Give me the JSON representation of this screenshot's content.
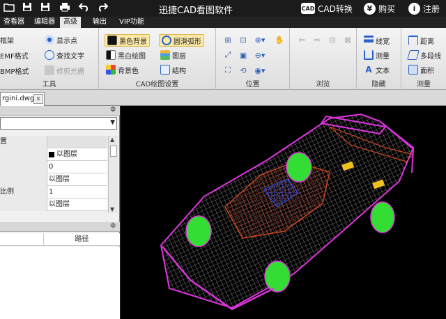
{
  "titlebar": {
    "title": "迅捷CAD看图软件",
    "cad_badge": "CAD",
    "convert_label": "CAD转换",
    "buy_label": "购买",
    "register_label": "注册",
    "yen": "¥",
    "info": "i"
  },
  "tabs": [
    "查看器",
    "编辑器",
    "高级",
    "输出",
    "VIP功能"
  ],
  "ribbon": {
    "tools": {
      "label": "工具",
      "items": [
        "框架",
        "EMF格式",
        "BMP格式",
        "显示点",
        "查找文字",
        "修剪光栅"
      ]
    },
    "cad_settings": {
      "label": "CAD绘图设置",
      "items": [
        "黑色背景",
        "黑白绘图",
        "背景色",
        "圆滑弧形",
        "图层",
        "结构"
      ]
    },
    "position": {
      "label": "位置"
    },
    "browse": {
      "label": "浏览"
    },
    "hide": {
      "label": "隐藏",
      "items": [
        "线宽",
        "测量",
        "文本"
      ]
    },
    "measure": {
      "label": "测量",
      "items": [
        "距离",
        "多段线",
        "面积"
      ]
    }
  },
  "document": {
    "filename": "rgini.dwg",
    "close": "x"
  },
  "properties": {
    "pin": "ф",
    "rows": [
      {
        "name": "置",
        "value": ""
      },
      {
        "name": "",
        "value": "以图层"
      },
      {
        "name": "",
        "value": "0"
      },
      {
        "name": "",
        "value": "以图层"
      },
      {
        "name": "比例",
        "value": "1"
      },
      {
        "name": "",
        "value": "以图层"
      }
    ]
  },
  "layers": {
    "pin": "ф",
    "column_path": "路径"
  },
  "colors": {
    "accent": "#fde9a8",
    "car_green": "#33dd33",
    "car_magenta": "#dd33dd",
    "car_red": "#cc4422",
    "car_blue": "#3355ff",
    "car_yellow": "#f0c020"
  }
}
